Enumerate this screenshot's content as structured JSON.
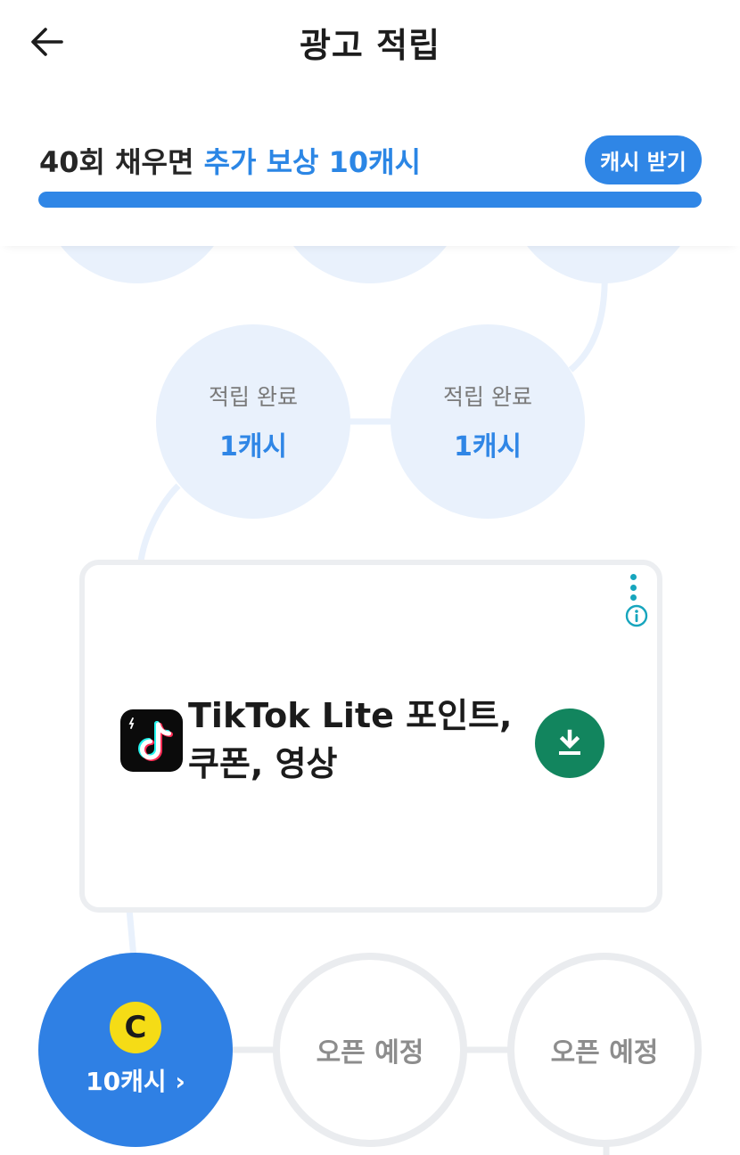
{
  "header": {
    "title": "광고 적립",
    "back_icon": "arrow-left-icon"
  },
  "reward": {
    "prefix": "40회 채우면",
    "accent": "추가 보상 10캐시",
    "button_label": "캐시 받기",
    "progress_percent": 100
  },
  "steps": [
    {
      "status": "적립 완료",
      "amount": "1캐시"
    },
    {
      "status": "적립 완료",
      "amount": "1캐시"
    }
  ],
  "current_step": {
    "coin_symbol": "C",
    "label": "10캐시 ›"
  },
  "pending_steps": [
    {
      "label": "오픈 예정"
    },
    {
      "label": "오픈 예정"
    }
  ],
  "ad": {
    "title_line1": "TikTok Lite 포인트,",
    "title_line2": "쿠폰, 영상",
    "app_icon": "tiktok-logo-icon",
    "cta_icon": "download-icon",
    "menu_icon": "kebab-menu-icon",
    "info_icon": "info-icon"
  },
  "colors": {
    "accent": "#2f86e6",
    "coin": "#f5dc16",
    "download": "#12855e"
  }
}
